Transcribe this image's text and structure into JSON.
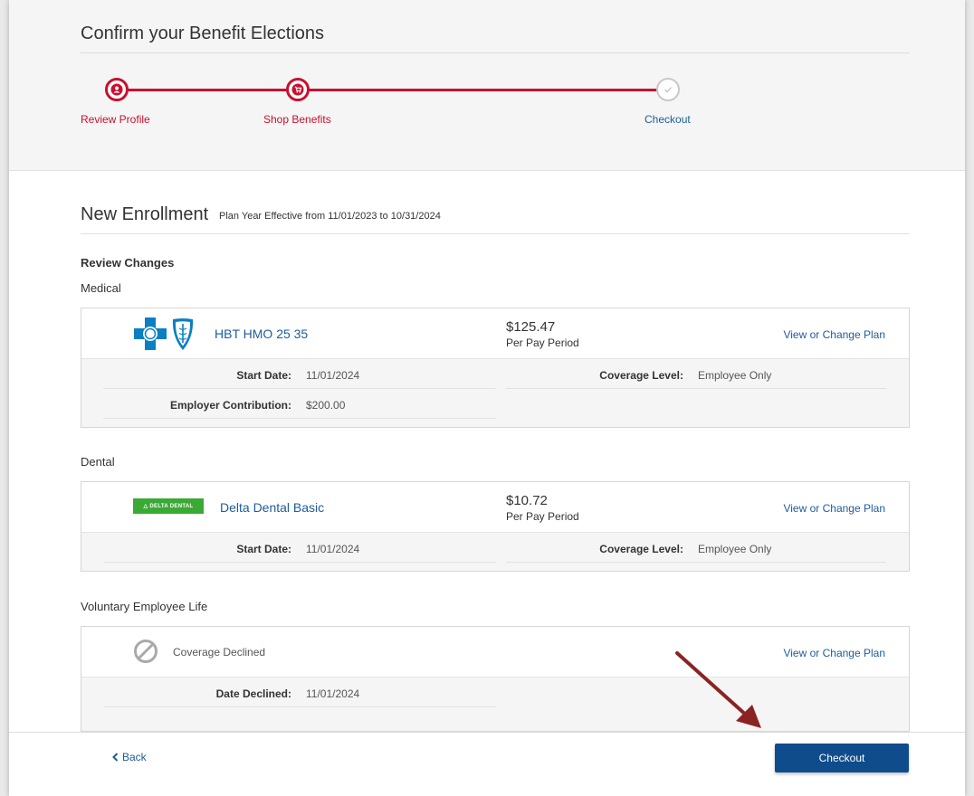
{
  "page_title": "Confirm your Benefit Elections",
  "steps": [
    {
      "label": "Review Profile",
      "state": "done",
      "icon": "user-icon"
    },
    {
      "label": "Shop Benefits",
      "state": "done",
      "icon": "cart-icon"
    },
    {
      "label": "Checkout",
      "state": "pending",
      "icon": "check-icon"
    }
  ],
  "colors": {
    "accent_red": "#c8102e",
    "link_blue": "#1d5c9a",
    "button_blue": "#0f4c8c",
    "delta_green": "#3aaa35",
    "arrow": "#8b2323"
  },
  "enrollment": {
    "title": "New Enrollment",
    "subtitle": "Plan Year Effective from 11/01/2023 to 10/31/2024",
    "review_heading": "Review Changes"
  },
  "plans": {
    "medical": {
      "section": "Medical",
      "logo": "bcbs-logo",
      "name": "HBT HMO 25 35",
      "price": "$125.47",
      "period": "Per Pay Period",
      "link": "View or Change Plan",
      "start_label": "Start Date:",
      "start_value": "11/01/2024",
      "coverage_label": "Coverage Level:",
      "coverage_value": "Employee Only",
      "contribution_label": "Employer Contribution:",
      "contribution_value": "$200.00"
    },
    "dental": {
      "section": "Dental",
      "logo_text": "△ DELTA DENTAL",
      "name": "Delta Dental Basic",
      "price": "$10.72",
      "period": "Per Pay Period",
      "link": "View or Change Plan",
      "start_label": "Start Date:",
      "start_value": "11/01/2024",
      "coverage_label": "Coverage Level:",
      "coverage_value": "Employee Only"
    },
    "life": {
      "section": "Voluntary Employee Life",
      "icon": "declined-icon",
      "status": "Coverage Declined",
      "link": "View or Change Plan",
      "declined_label": "Date Declined:",
      "declined_value": "11/01/2024"
    }
  },
  "footer": {
    "back_label": "Back",
    "checkout_label": "Checkout"
  }
}
